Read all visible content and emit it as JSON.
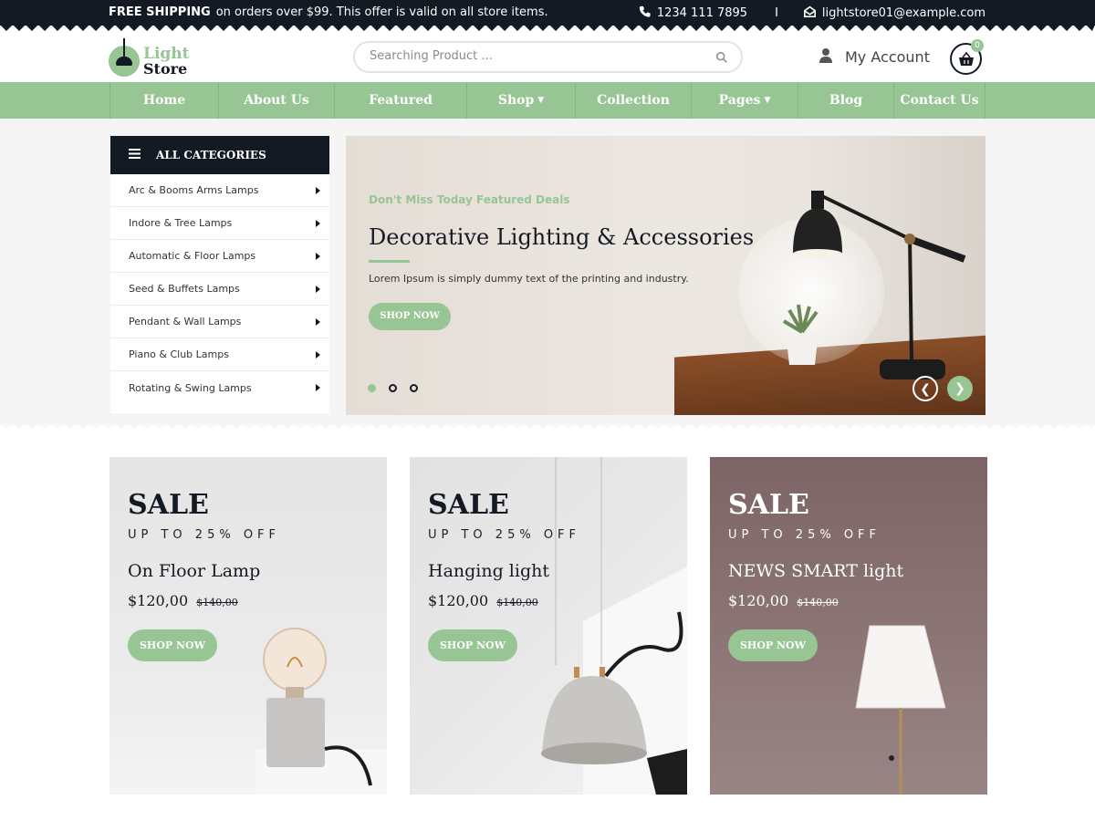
{
  "topbar": {
    "shipping_bold": "FREE SHIPPING",
    "shipping_text": "on orders over $99. This offer is valid on all store items.",
    "phone": "1234 111 7895",
    "separator": "I",
    "email": "lightstore01@example.com"
  },
  "header": {
    "logo_line1": "Light",
    "logo_line2": "Store",
    "search_placeholder": "Searching Product ...",
    "account_label": "My Account",
    "cart_count": "0"
  },
  "nav": {
    "items": [
      {
        "label": "Home"
      },
      {
        "label": "About Us"
      },
      {
        "label": "Featured"
      },
      {
        "label": "Shop"
      },
      {
        "label": "Collection"
      },
      {
        "label": "Pages"
      },
      {
        "label": "Blog"
      },
      {
        "label": "Contact Us"
      }
    ]
  },
  "categories": {
    "title": "ALL CATEGORIES",
    "items": [
      "Arc & Booms Arms Lamps",
      "Indore & Tree Lamps",
      "Automatic & Floor Lamps",
      "Seed & Buffets Lamps",
      "Pendant & Wall Lamps",
      "Piano & Club Lamps",
      "Rotating & Swing Lamps"
    ]
  },
  "hero": {
    "subtitle": "Don't Miss Today Featured Deals",
    "title": "Decorative Lighting & Accessories",
    "description": "Lorem Ipsum is simply dummy text of the printing and industry.",
    "button": "SHOP NOW",
    "active_slide": 1,
    "slide_count": 3
  },
  "banners": [
    {
      "sale": "SALE",
      "off": "UP TO 25% OFF",
      "name": "On Floor Lamp",
      "price": "$120,00",
      "old_price": "$140,00",
      "button": "SHOP NOW"
    },
    {
      "sale": "SALE",
      "off": "UP TO 25% OFF",
      "name": "Hanging light",
      "price": "$120,00",
      "old_price": "$140,00",
      "button": "SHOP NOW"
    },
    {
      "sale": "SALE",
      "off": "UP TO 25% OFF",
      "name": "NEWS SMART light",
      "price": "$120,00",
      "old_price": "$140,00",
      "button": "SHOP NOW"
    }
  ],
  "colors": {
    "accent": "#97c593",
    "dark": "#131a24"
  }
}
